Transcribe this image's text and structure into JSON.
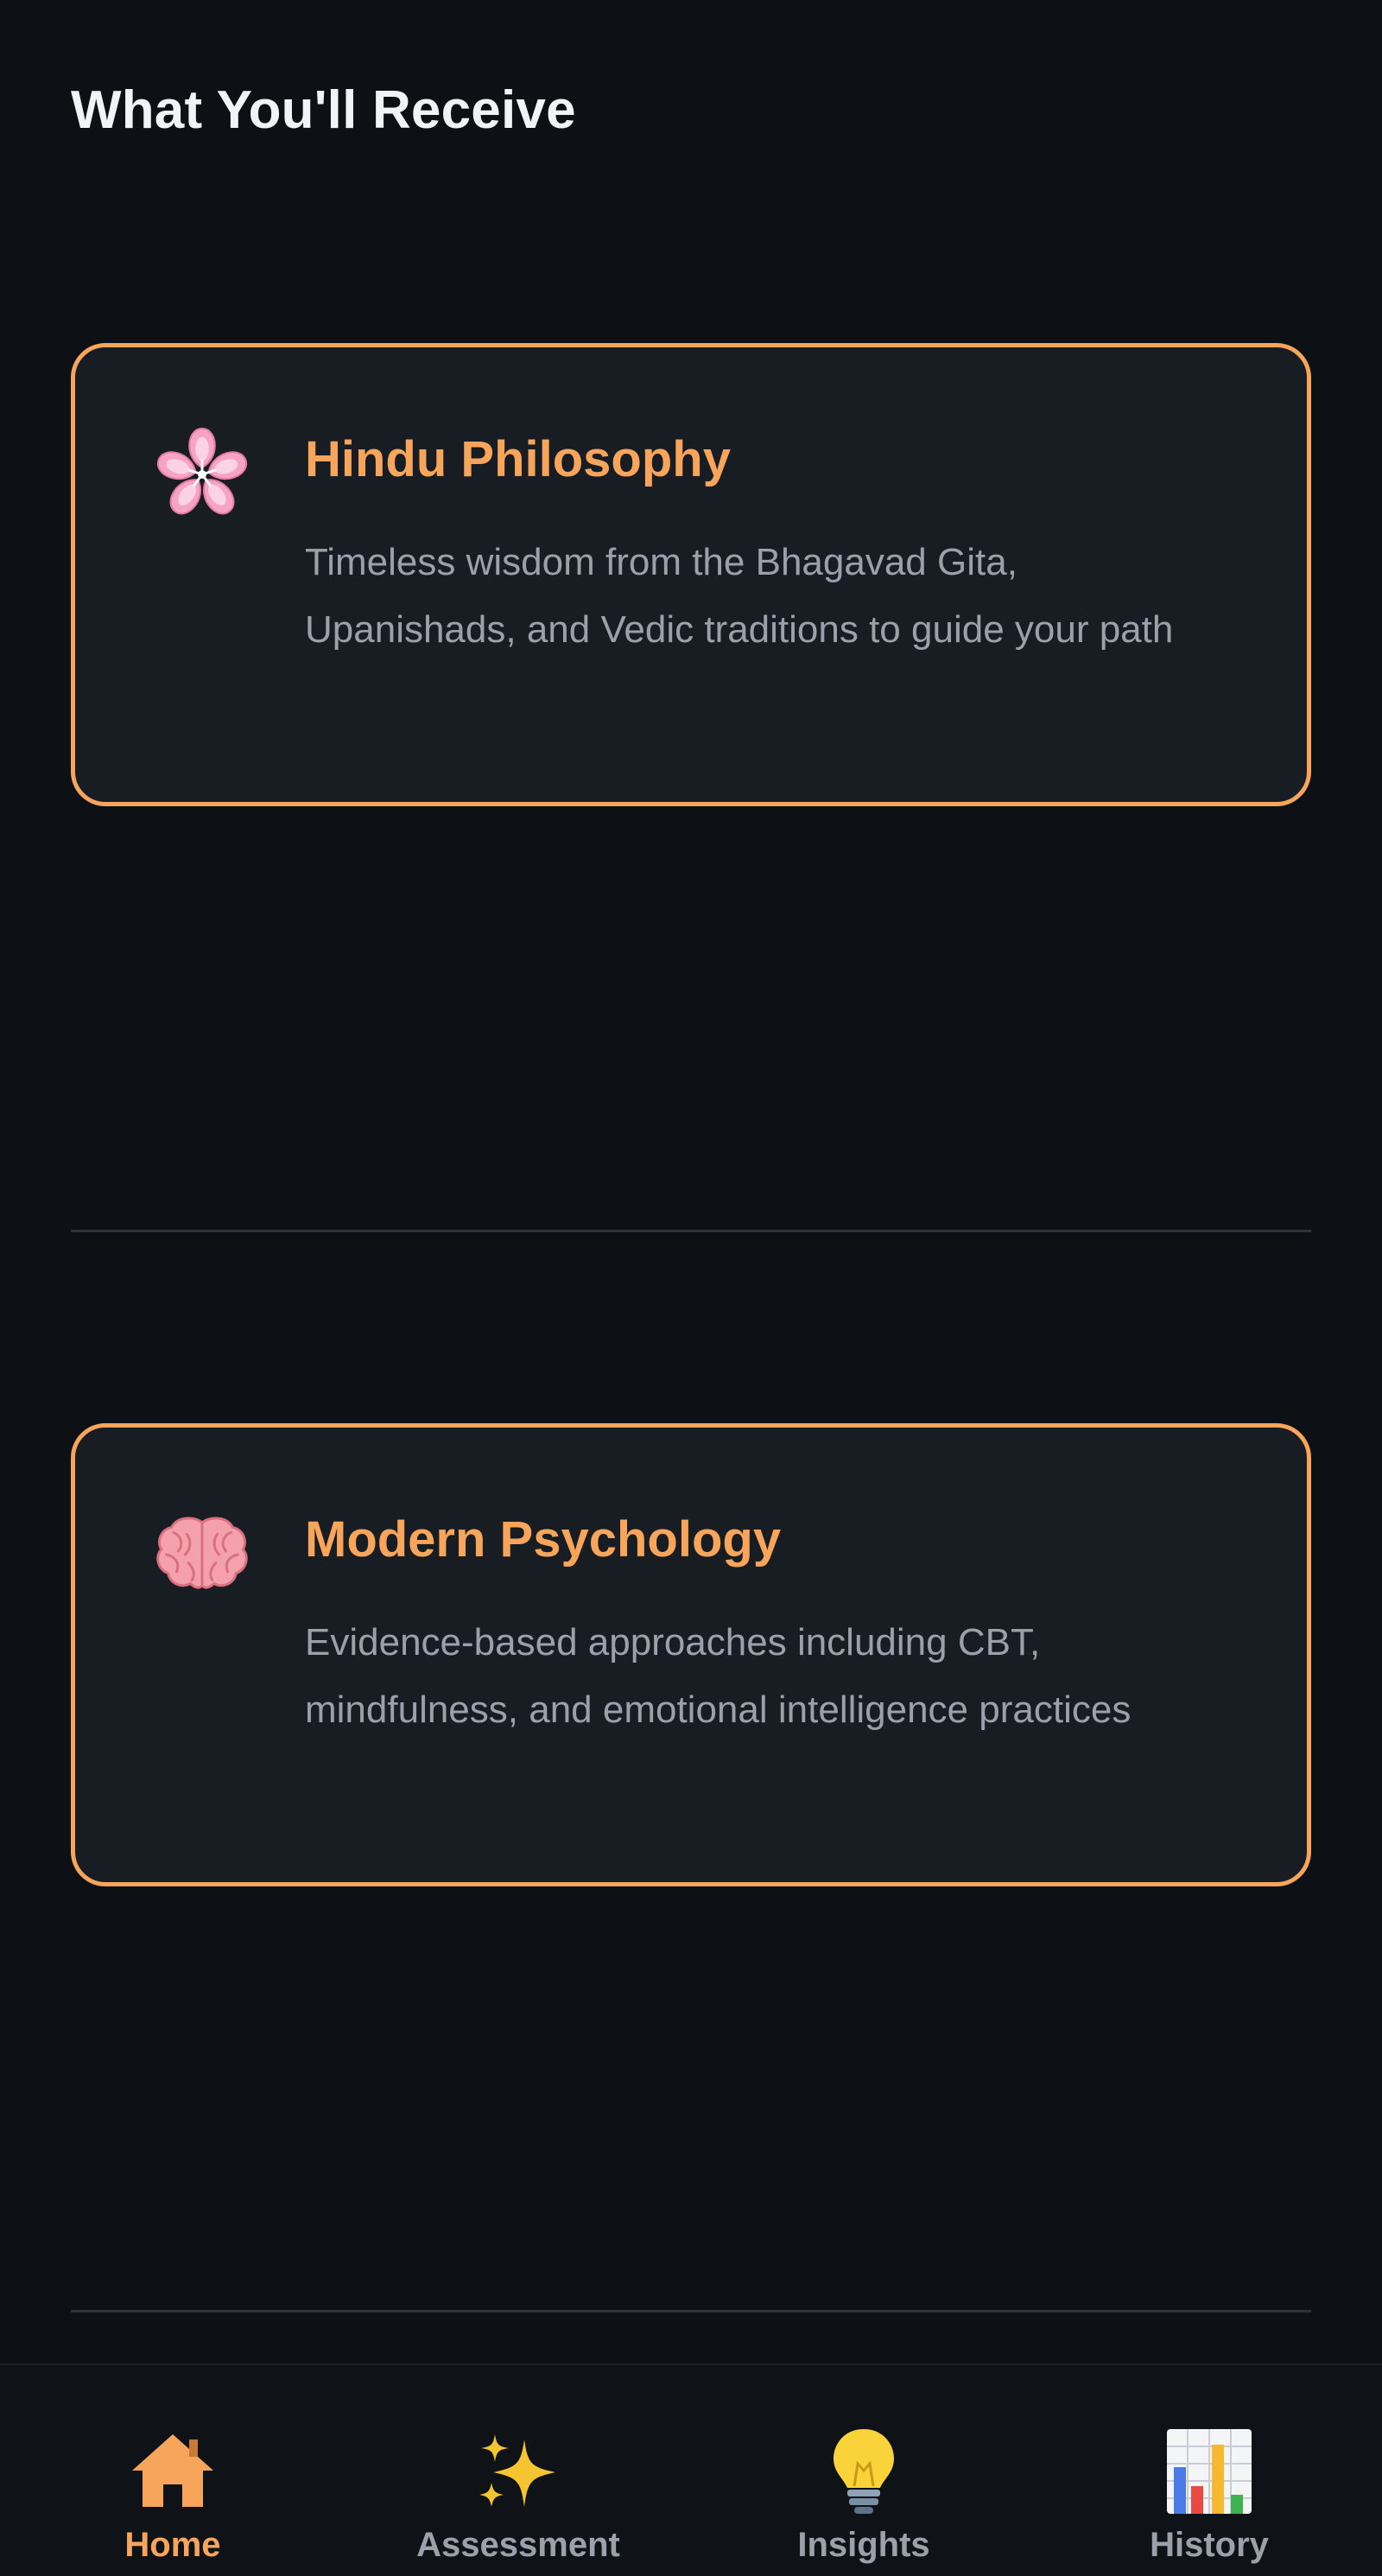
{
  "section": {
    "title": "What You'll Receive"
  },
  "cards": [
    {
      "icon": "cherry-blossom-icon",
      "title": "Hindu Philosophy",
      "description": "Timeless wisdom from the Bhagavad Gita, Upanishads, and Vedic traditions to guide your path"
    },
    {
      "icon": "brain-icon",
      "title": "Modern Psychology",
      "description": "Evidence-based approaches including CBT, mindfulness, and emotional intelligence practices"
    }
  ],
  "nav": {
    "items": [
      {
        "label": "Home",
        "icon": "home-icon",
        "active": true
      },
      {
        "label": "Assessment",
        "icon": "sparkles-icon",
        "active": false
      },
      {
        "label": "Insights",
        "icon": "lightbulb-icon",
        "active": false
      },
      {
        "label": "History",
        "icon": "bar-chart-icon",
        "active": false
      }
    ]
  },
  "colors": {
    "background": "#0d1014",
    "card_background": "#181c23",
    "accent": "#f6a55a",
    "muted_text": "#9ba1ab",
    "divider": "#2e333b"
  }
}
